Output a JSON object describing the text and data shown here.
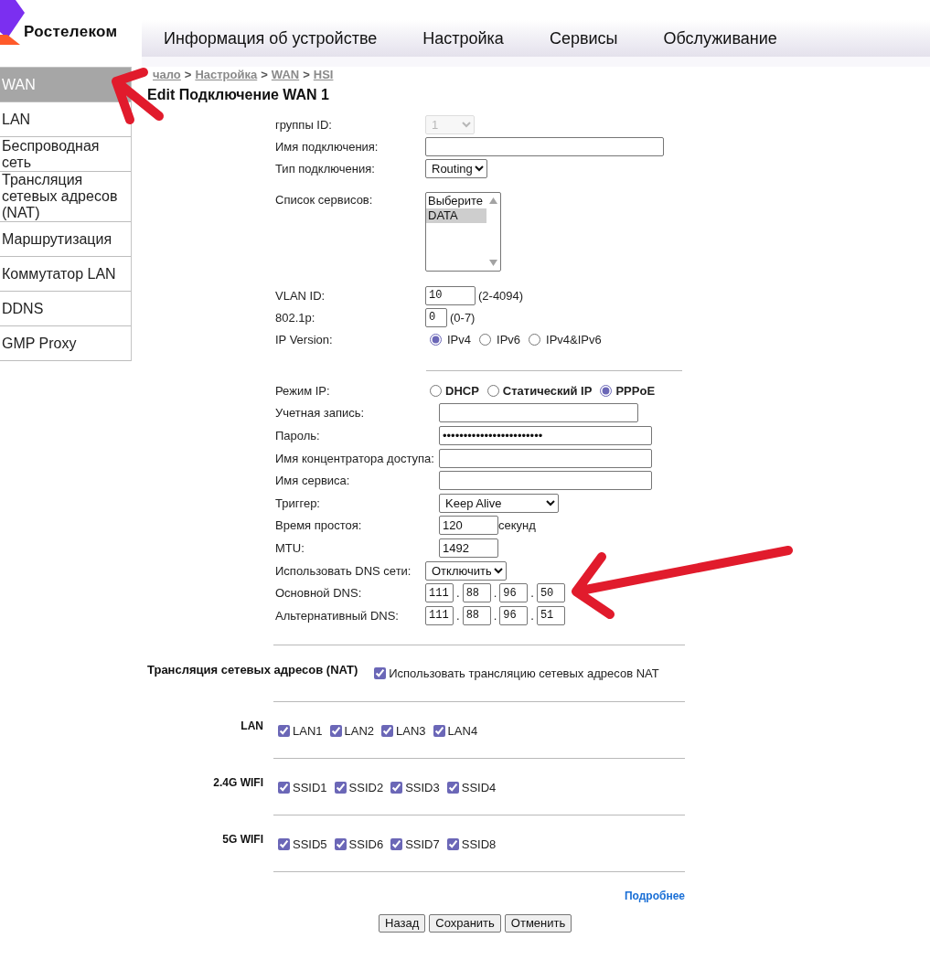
{
  "logo": {
    "text": "Ростелеком"
  },
  "nav": [
    {
      "label": "Информация об устройстве"
    },
    {
      "label": "Настройка"
    },
    {
      "label": "Сервисы"
    },
    {
      "label": "Обслуживание"
    }
  ],
  "sidebar": {
    "items": [
      {
        "label": "WAN",
        "selected": true
      },
      {
        "label": "LAN",
        "selected": false
      },
      {
        "label": "Беспроводная сеть",
        "selected": false
      },
      {
        "label": "Трансляция сетевых адресов (NAT)",
        "selected": false
      },
      {
        "label": "Маршрутизация",
        "selected": false
      },
      {
        "label": "Коммутатор LAN",
        "selected": false
      },
      {
        "label": "DDNS",
        "selected": false
      },
      {
        "label": "GMP Proxy",
        "selected": false
      }
    ]
  },
  "breadcrumb": [
    "чало",
    ">",
    "Настройка",
    ">",
    "WAN",
    ">",
    "HSI"
  ],
  "title": "Edit Подключение WAN 1",
  "connection": {
    "rows": [
      {
        "kind": "select",
        "label": "группы ID:",
        "value": "1",
        "disabled": true
      },
      {
        "kind": "text",
        "label": "Имя подключения:"
      },
      {
        "kind": "select",
        "label": "Тип подключения:",
        "value": "Routing",
        "disabled": false
      },
      {
        "kind": "listbox",
        "label": "Список сервисов:",
        "options": [
          {
            "label": "Выберите",
            "selected": false
          },
          {
            "label": "DATA",
            "selected": true
          }
        ]
      },
      {
        "kind": "number",
        "label": "VLAN ID:",
        "value": "10",
        "hint": "(2-4094)"
      },
      {
        "kind": "number",
        "label": "802.1p:",
        "value": "0",
        "hint": "(0-7)"
      },
      {
        "kind": "radio",
        "label": "IP Version:",
        "options": [
          {
            "label": "IPv4",
            "selected": true
          },
          {
            "label": "IPv6",
            "selected": false
          },
          {
            "label": "IPv4&IPv6",
            "selected": false
          }
        ]
      }
    ]
  },
  "pppoe": {
    "rows": [
      {
        "kind": "radio",
        "label": "Режим IP:",
        "options": [
          {
            "label": "DHCP",
            "selected": false
          },
          {
            "label": "Статический IP",
            "selected": false
          },
          {
            "label": "PPPoE",
            "selected": true
          }
        ]
      },
      {
        "kind": "text",
        "label": "Учетная запись:"
      },
      {
        "kind": "text",
        "label": "Пароль:",
        "value": "••••••••••••••••••••••••"
      },
      {
        "kind": "text",
        "label": "Имя концентратора доступа:"
      },
      {
        "kind": "text",
        "label": "Имя сервиса:"
      },
      {
        "kind": "select",
        "label": "Триггер:",
        "value": "Keep Alive",
        "disabled": false
      },
      {
        "kind": "number",
        "label": "Время простоя:",
        "value": "120",
        "hint": "секунд"
      },
      {
        "kind": "number",
        "label": "MTU:",
        "value": "1492"
      }
    ]
  },
  "dns": {
    "rows": [
      {
        "kind": "select",
        "label": "Использовать DNS сети:",
        "value": "Отключить",
        "disabled": false
      },
      {
        "kind": "ip",
        "label": "Основной DNS:",
        "parts": [
          "111",
          ".",
          "88",
          ".",
          "96",
          ".",
          "50"
        ]
      },
      {
        "kind": "ip",
        "label": "Альтернативный DNS:",
        "parts": [
          "111",
          ".",
          "88",
          ".",
          "96",
          ".",
          "51"
        ]
      }
    ]
  },
  "nat": {
    "label": "Трансляция сетевых адресов (NAT)",
    "option": {
      "label": "Использовать трансляцию сетевых адресов NAT",
      "checked": true
    }
  },
  "port_groups": [
    {
      "label": "LAN",
      "options": [
        {
          "label": "LAN1",
          "checked": true
        },
        {
          "label": "LAN2",
          "checked": true
        },
        {
          "label": "LAN3",
          "checked": true
        },
        {
          "label": "LAN4",
          "checked": true
        }
      ]
    },
    {
      "label": "2.4G WIFI",
      "options": [
        {
          "label": "SSID1",
          "checked": true
        },
        {
          "label": "SSID2",
          "checked": true
        },
        {
          "label": "SSID3",
          "checked": true
        },
        {
          "label": "SSID4",
          "checked": true
        }
      ]
    },
    {
      "label": "5G WIFI",
      "options": [
        {
          "label": "SSID5",
          "checked": true
        },
        {
          "label": "SSID6",
          "checked": true
        },
        {
          "label": "SSID7",
          "checked": true
        },
        {
          "label": "SSID8",
          "checked": true
        }
      ]
    }
  ],
  "more_link": "Подробнее",
  "buttons": [
    "Назад",
    "Сохранить",
    "Отменить"
  ],
  "annotations": [
    {
      "kind": "arrow"
    },
    {
      "kind": "arrow"
    }
  ]
}
